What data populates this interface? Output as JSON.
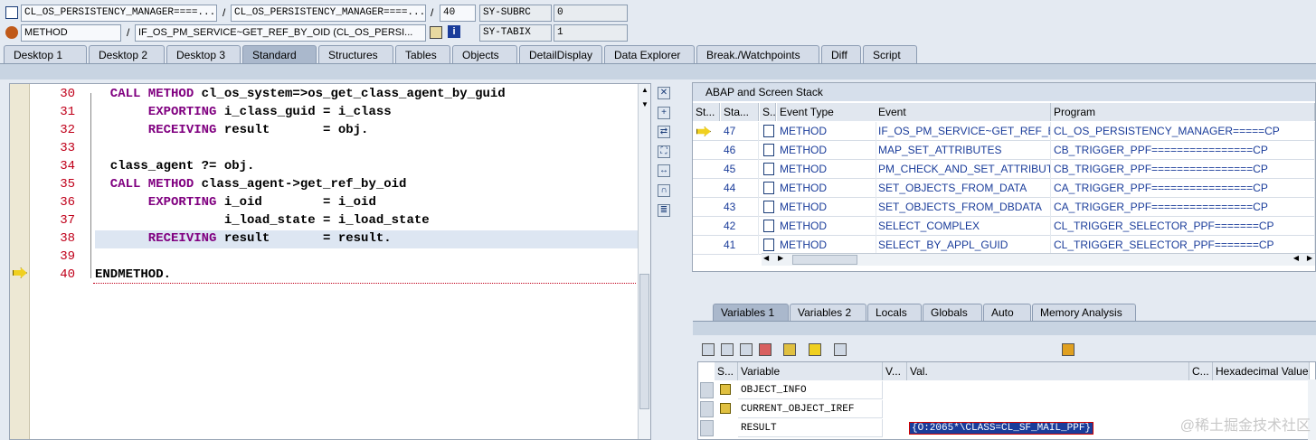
{
  "top": {
    "row1": {
      "program": "CL_OS_PERSISTENCY_MANAGER====...",
      "include": "CL_OS_PERSISTENCY_MANAGER====...",
      "line": "40",
      "sysvar": "SY-SUBRC",
      "sysval": "0",
      "sep": "/"
    },
    "row2": {
      "event_type": "METHOD",
      "event": "IF_OS_PM_SERVICE~GET_REF_BY_OID (CL_OS_PERSI...",
      "sysvar": "SY-TABIX",
      "sysval": "1",
      "sep": "/"
    }
  },
  "tabs": [
    "Desktop 1",
    "Desktop 2",
    "Desktop 3",
    "Standard",
    "Structures",
    "Tables",
    "Objects",
    "DetailDisplay",
    "Data Explorer",
    "Break./Watchpoints",
    "Diff",
    "Script"
  ],
  "active_tab": "Standard",
  "editor": {
    "lines": [
      {
        "num": "30",
        "parts": [
          [
            "kw",
            "  CALL METHOD"
          ],
          [
            "",
            " cl_os_system=>os_get_class_agent_by_guid"
          ]
        ]
      },
      {
        "num": "31",
        "parts": [
          [
            "kw",
            "       EXPORTING"
          ],
          [
            "",
            " i_class_guid = i_class"
          ]
        ]
      },
      {
        "num": "32",
        "parts": [
          [
            "kw",
            "       RECEIVING"
          ],
          [
            "",
            " result       = obj."
          ]
        ]
      },
      {
        "num": "33",
        "parts": [
          [
            "",
            ""
          ]
        ]
      },
      {
        "num": "34",
        "parts": [
          [
            "",
            "  class_agent ?= obj."
          ]
        ]
      },
      {
        "num": "35",
        "parts": [
          [
            "kw",
            "  CALL METHOD"
          ],
          [
            "",
            " class_agent->get_ref_by_oid"
          ]
        ]
      },
      {
        "num": "36",
        "parts": [
          [
            "kw",
            "       EXPORTING"
          ],
          [
            "",
            " i_oid        = i_oid"
          ]
        ]
      },
      {
        "num": "37",
        "parts": [
          [
            "",
            "                 i_load_state = i_load_state"
          ]
        ]
      },
      {
        "num": "38",
        "parts": [
          [
            "kw",
            "       RECEIVING"
          ],
          [
            "",
            " result       = result."
          ]
        ]
      },
      {
        "num": "39",
        "parts": [
          [
            "",
            ""
          ]
        ]
      },
      {
        "num": "40",
        "parts": [
          [
            "",
            "ENDMETHOD."
          ]
        ]
      }
    ]
  },
  "stack": {
    "title": "ABAP and Screen Stack",
    "columns": [
      "St...",
      "Sta...",
      "S...",
      "Event Type",
      "Event",
      "Program"
    ],
    "rows": [
      {
        "level": "47",
        "type": "METHOD",
        "event": "IF_OS_PM_SERVICE~GET_REF_B...",
        "program": "CL_OS_PERSISTENCY_MANAGER=====CP",
        "current": true
      },
      {
        "level": "46",
        "type": "METHOD",
        "event": "MAP_SET_ATTRIBUTES",
        "program": "CB_TRIGGER_PPF================CP"
      },
      {
        "level": "45",
        "type": "METHOD",
        "event": "PM_CHECK_AND_SET_ATTRIBUT...",
        "program": "CB_TRIGGER_PPF================CP"
      },
      {
        "level": "44",
        "type": "METHOD",
        "event": "SET_OBJECTS_FROM_DATA",
        "program": "CA_TRIGGER_PPF================CP"
      },
      {
        "level": "43",
        "type": "METHOD",
        "event": "SET_OBJECTS_FROM_DBDATA",
        "program": "CA_TRIGGER_PPF================CP"
      },
      {
        "level": "42",
        "type": "METHOD",
        "event": "SELECT_COMPLEX",
        "program": "CL_TRIGGER_SELECTOR_PPF=======CP"
      },
      {
        "level": "41",
        "type": "METHOD",
        "event": "SELECT_BY_APPL_GUID",
        "program": "CL_TRIGGER_SELECTOR_PPF=======CP"
      }
    ]
  },
  "vartabs": [
    "Variables 1",
    "Variables 2",
    "Locals",
    "Globals",
    "Auto",
    "Memory Analysis"
  ],
  "vars": {
    "columns": [
      "S...",
      "Variable",
      "V...",
      "Val.",
      "C...",
      "Hexadecimal Value"
    ],
    "rows": [
      {
        "name": "OBJECT_INFO",
        "value": ""
      },
      {
        "name": "CURRENT_OBJECT_IREF",
        "value": ""
      },
      {
        "name": "RESULT",
        "value": "{O:2065*\\CLASS=CL_SF_MAIL_PPF}"
      }
    ]
  },
  "watermark": "@稀土掘金技术社区"
}
